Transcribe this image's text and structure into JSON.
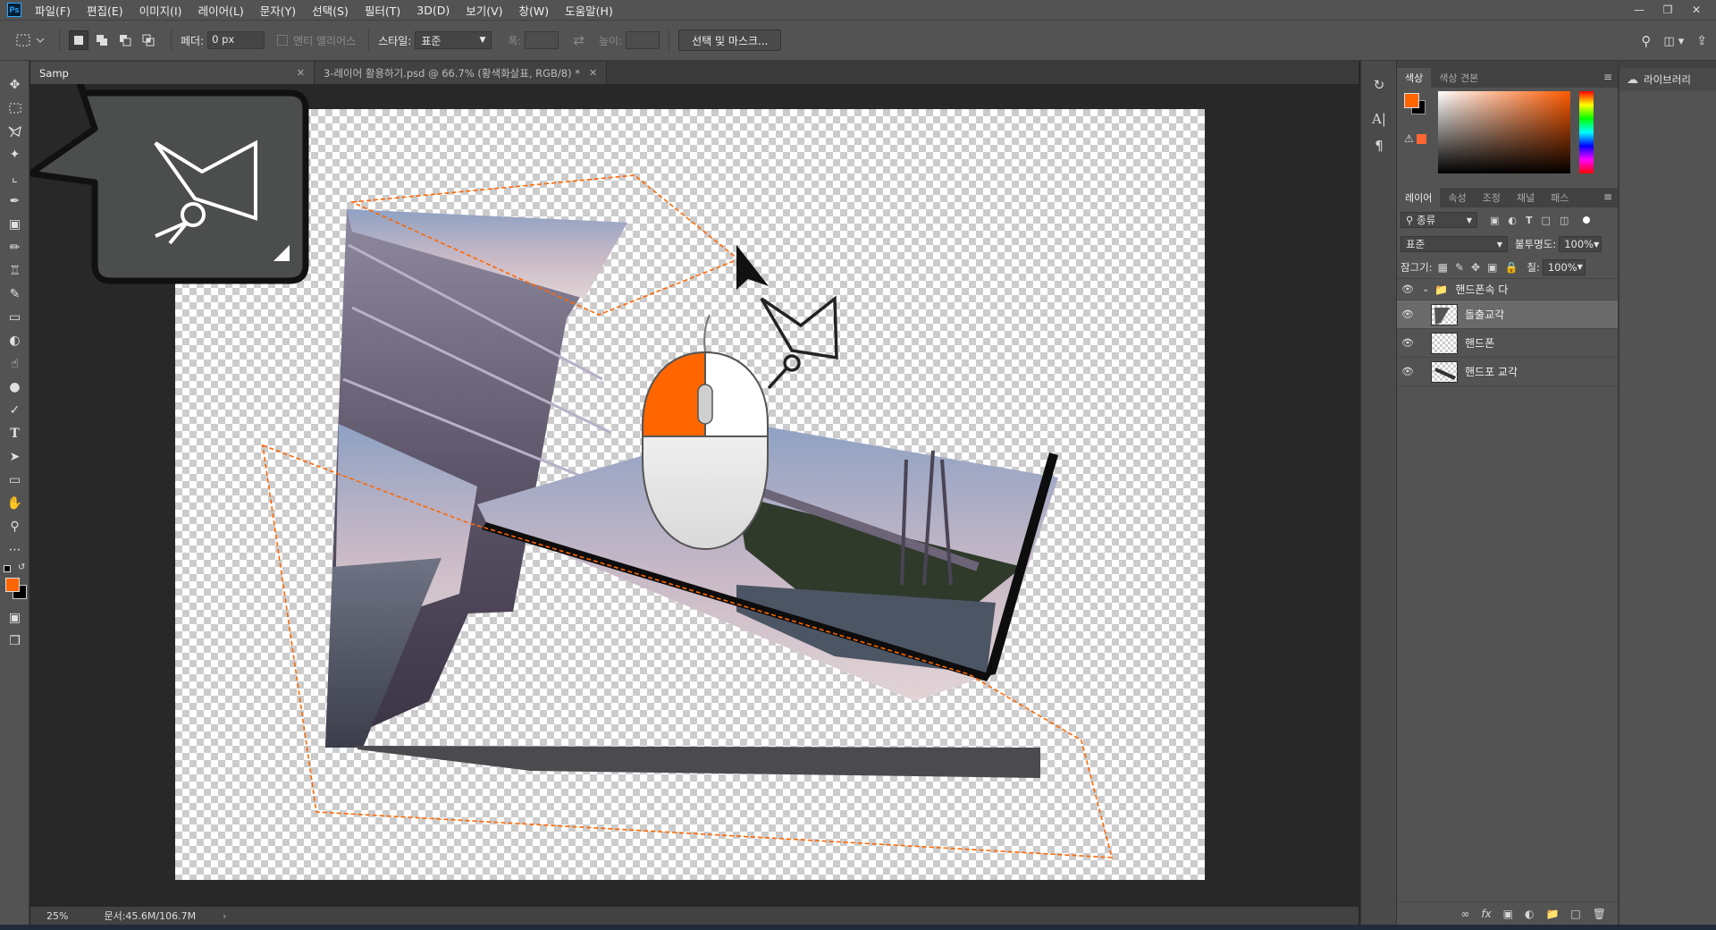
{
  "app": {
    "logo": "Ps",
    "menus": [
      "파일(F)",
      "편집(E)",
      "이미지(I)",
      "레이어(L)",
      "문자(Y)",
      "선택(S)",
      "필터(T)",
      "3D(D)",
      "보기(V)",
      "창(W)",
      "도움말(H)"
    ]
  },
  "options": {
    "feather_label": "페더:",
    "feather_value": "0 px",
    "antialias_label": "앤티 앨리어스",
    "style_label": "스타일:",
    "style_value": "표준",
    "width_label": "폭:",
    "height_label": "높이:",
    "select_mask_label": "선택 및 마스크..."
  },
  "tabs": [
    {
      "label": "Samp",
      "active": true
    },
    {
      "label": "3-레이어 활용하기.psd @ 66.7% (황색화살표, RGB/8) *",
      "active": false
    }
  ],
  "status": {
    "zoom": "25%",
    "doc_size": "문서:45.6M/106.7M"
  },
  "color_panel": {
    "tabs": [
      "색상",
      "색상 견본"
    ],
    "foreground": "#ff6600",
    "background": "#000000"
  },
  "layers_panel": {
    "tabs": [
      "레이어",
      "속성",
      "조정",
      "채널",
      "패스"
    ],
    "filter_label": "종류",
    "blend_mode": "표준",
    "opacity_label": "불투명도:",
    "opacity_value": "100%",
    "lock_label": "잠그기:",
    "fill_label": "칠:",
    "fill_value": "100%",
    "group_name": "핸드폰속 다",
    "layers": [
      {
        "name": "돌출교각",
        "selected": true
      },
      {
        "name": "핸드폰",
        "selected": false
      },
      {
        "name": "핸드포 교각",
        "selected": false
      }
    ]
  },
  "libraries": {
    "label": "라이브러리"
  },
  "colors": {
    "accent": "#ff6600",
    "ui_bg": "#535353",
    "canvas_bg": "#282828",
    "selection_dash": "#ff6600"
  }
}
